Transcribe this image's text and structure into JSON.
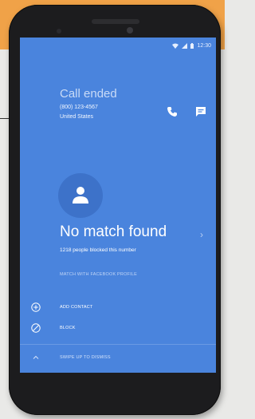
{
  "status_bar": {
    "time": "12:30"
  },
  "call": {
    "status": "Call ended",
    "number": "(800) 123-4567",
    "country": "United States"
  },
  "caller": {
    "title": "No match found",
    "blocked_text": "1218 people blocked this number",
    "facebook_link": "MATCH WITH FACEBOOK PROFILE"
  },
  "actions": {
    "add_contact": "ADD CONTACT",
    "block": "BLOCK",
    "swipe": "SWIPE UP TO DISMISS"
  },
  "icons": {
    "call": "phone-icon",
    "message": "message-icon",
    "avatar": "person-icon",
    "add": "add-circle-icon",
    "block": "block-icon",
    "swipe": "chevron-up-icon"
  },
  "colors": {
    "screen": "#4a84dd",
    "accent_orange": "#f0a248"
  }
}
